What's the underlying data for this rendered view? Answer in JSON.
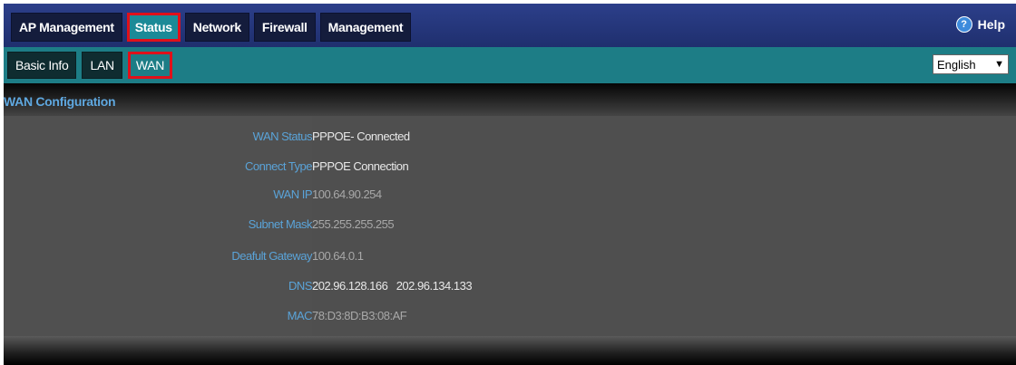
{
  "main_nav": {
    "tabs": [
      {
        "label": "AP Management"
      },
      {
        "label": "Status"
      },
      {
        "label": "Network"
      },
      {
        "label": "Firewall"
      },
      {
        "label": "Management"
      }
    ],
    "active": "Status",
    "help_label": "Help"
  },
  "sub_nav": {
    "tabs": [
      {
        "label": "Basic Info"
      },
      {
        "label": "LAN"
      },
      {
        "label": "WAN"
      }
    ],
    "active": "WAN",
    "language": "English"
  },
  "section": {
    "title": "WAN Configuration"
  },
  "wan": {
    "status_label": "WAN Status",
    "status_value": "PPPOE- Connected",
    "connect_type_label": "Connect Type",
    "connect_type_value": "PPPOE Connection",
    "ip_label": "WAN IP",
    "ip_value": "100.64.90.254",
    "mask_label": "Subnet Mask",
    "mask_value": "255.255.255.255",
    "gateway_label": "Deafult Gateway",
    "gateway_value": "100.64.0.1",
    "dns_label": "DNS",
    "dns_value": "202.96.128.166   202.96.134.133",
    "mac_label": "MAC",
    "mac_value": "78:D3:8D:B3:08:AF"
  },
  "colors": {
    "top_bar": "#2c3f8a",
    "sub_bar": "#1d7d86",
    "highlight": "#e0101a",
    "label_blue": "#5aa3d8"
  }
}
